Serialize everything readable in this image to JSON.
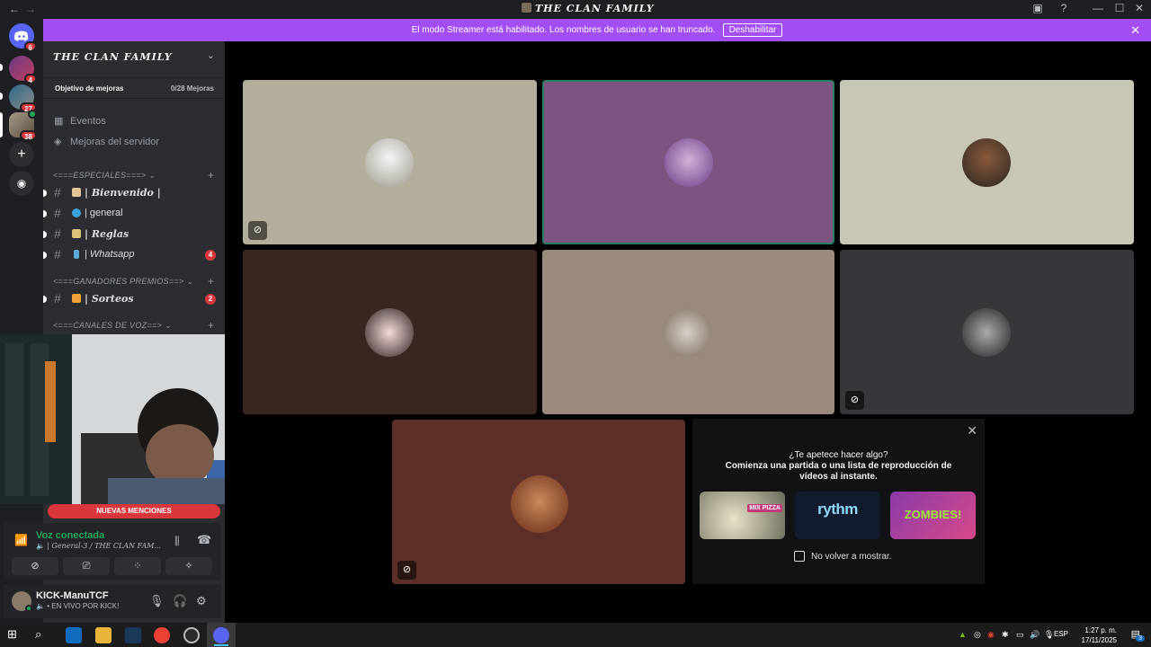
{
  "window": {
    "title": "THE CLAN FAMILY",
    "back": "←",
    "forward": "→",
    "minimize": "—",
    "maximize": "☐",
    "close": "✕"
  },
  "banner": {
    "text": "El modo Streamer está habilitado. Los nombres de usuario se han truncado.",
    "button": "Deshabilitar",
    "close": "✕"
  },
  "rail": {
    "home_badge": "6",
    "servers": [
      {
        "badge": "4"
      },
      {
        "badge": "27"
      },
      {
        "badge": "38"
      }
    ]
  },
  "sidebar": {
    "server_name": "THE CLAN FAMILY",
    "boost_goal": "Objetivo de mejoras",
    "boost_count": "0/28 Mejoras",
    "links": [
      {
        "label": "Eventos",
        "icon": "calendar-icon"
      },
      {
        "label": "Mejoras del servidor",
        "icon": "boost-gem-icon"
      }
    ],
    "categories": [
      {
        "label": "<===ESPECIALES===>"
      },
      {
        "label": "<===GANADORES PREMIOS==>"
      },
      {
        "label": "<===CANALES DE VOZ==>"
      }
    ],
    "channels": [
      {
        "name": "| Bienvenido |",
        "badge": ""
      },
      {
        "name": "| general",
        "badge": ""
      },
      {
        "name": "| Reglas",
        "badge": ""
      },
      {
        "name": "| Whatsapp",
        "badge": "4"
      },
      {
        "name": "| Sorteos",
        "badge": "2"
      }
    ]
  },
  "mentions": "NUEVAS MENCIONES",
  "voice": {
    "status": "Voz conectada",
    "channel": "| General-3 / THE CLAN FAM..."
  },
  "user": {
    "name": "KICK-ManuTCF",
    "status": "• EN VIVO POR KICK!"
  },
  "activity": {
    "title_line1": "¿Te apetece hacer algo?",
    "title_line2": "Comienza una partida o una lista de reproducción de vídeos al instante.",
    "checkbox_label": "No volver a mostrar.",
    "games": [
      {
        "name": "Mix Pizza",
        "label": "MIX PIZZA"
      },
      {
        "name": "Rythm",
        "label": "rythm"
      },
      {
        "name": "Zombies",
        "label": "ZOMBIES!"
      }
    ]
  },
  "taskbar": {
    "lang": "ESP",
    "time": "1:27 p. m.",
    "date": "17/11/2025",
    "notif_count": "3"
  },
  "colors": {
    "banner": "#a34df5",
    "accent_green": "#23a55a",
    "badge_red": "#da373c"
  }
}
